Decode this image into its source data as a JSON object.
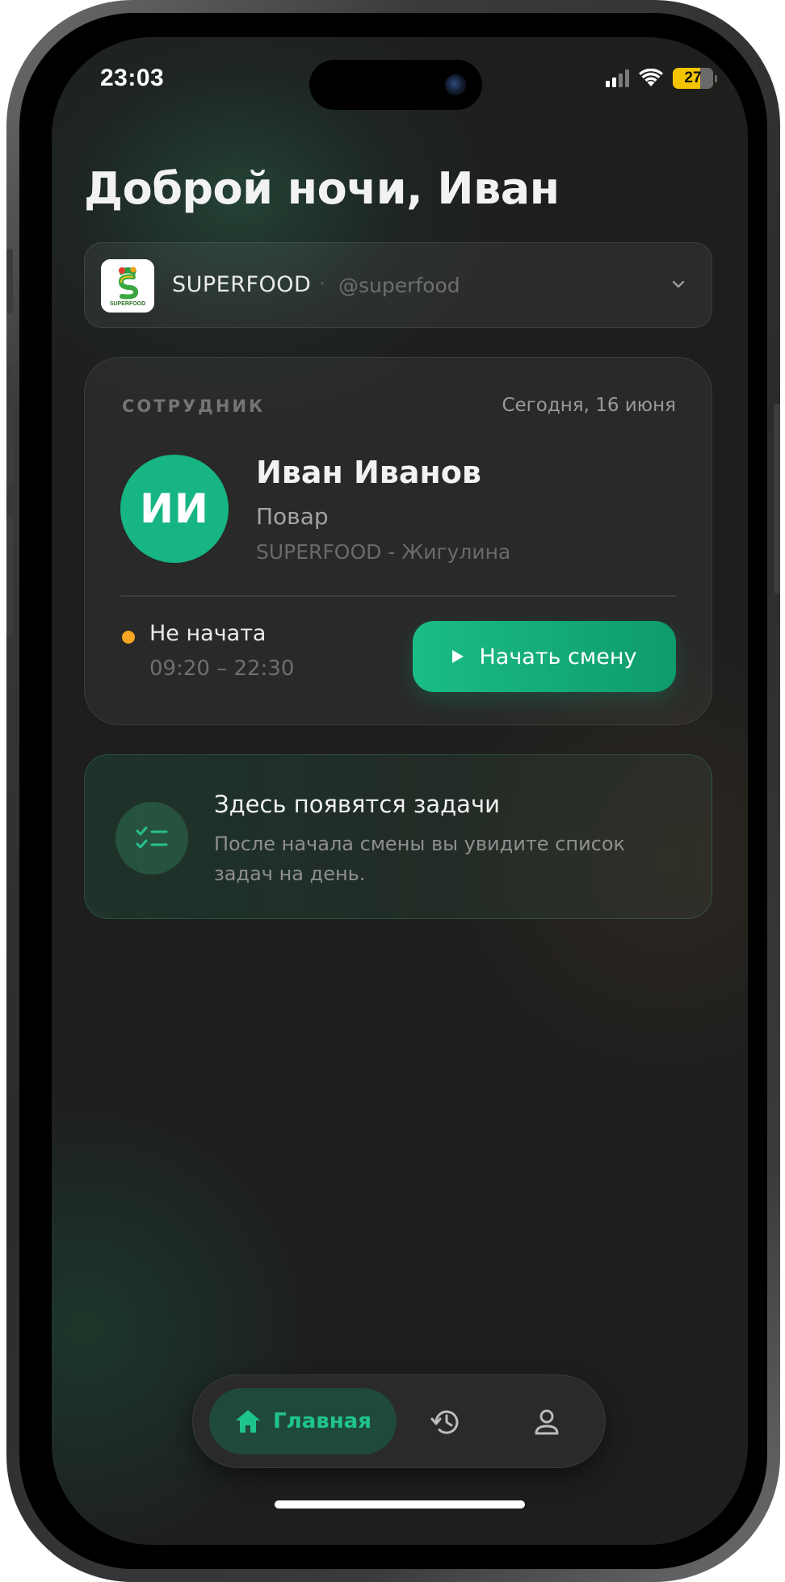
{
  "status_bar": {
    "time": "23:03",
    "battery": "27"
  },
  "greeting": "Доброй ночи, Иван",
  "company": {
    "name": "SUPERFOOD",
    "separator": "·",
    "handle": "@superfood",
    "logo_text": "SUPERFOOD"
  },
  "employee_card": {
    "label": "СОТРУДНИК",
    "date": "Сегодня, 16 июня",
    "initials": "ИИ",
    "name": "Иван Иванов",
    "role": "Повар",
    "location": "SUPERFOOD - Жигулина",
    "shift_status": "Не начата",
    "shift_time": "09:20 – 22:30",
    "start_button": "Начать смену"
  },
  "tasks": {
    "title": "Здесь появятся задачи",
    "description": "После начала смены вы увидите список задач на день."
  },
  "nav": {
    "home_label": "Главная"
  },
  "colors": {
    "accent": "#17b584",
    "status_pending": "#f5a623",
    "background": "#1e1e1d",
    "battery": "#f3c400"
  },
  "icons": {
    "nav_home": "home-icon",
    "nav_history": "history-icon",
    "nav_profile": "profile-icon",
    "tasks": "checklist-icon",
    "company_dropdown": "chevron-down-icon",
    "start": "play-icon"
  }
}
